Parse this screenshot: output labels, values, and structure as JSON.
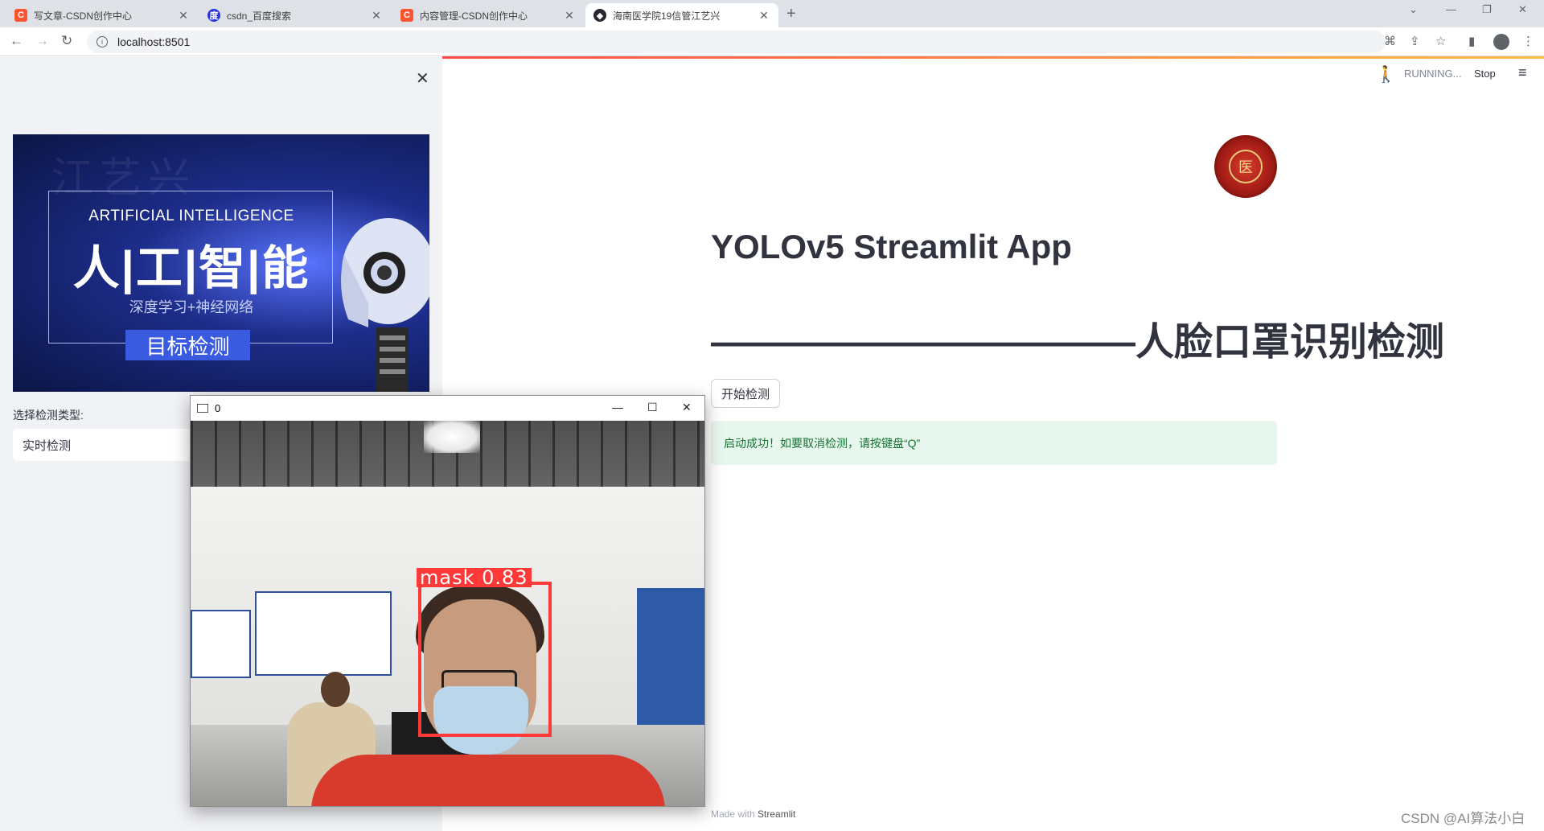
{
  "browser": {
    "tabs": [
      {
        "title": "写文章-CSDN创作中心",
        "favicon": "C",
        "color": "#fc5531"
      },
      {
        "title": "csdn_百度搜索",
        "favicon": "du",
        "color": "#2932e1"
      },
      {
        "title": "内容管理-CSDN创作中心",
        "favicon": "C",
        "color": "#fc5531"
      },
      {
        "title": "海南医学院19信管江艺兴",
        "favicon": "st",
        "color": "#262730"
      }
    ],
    "new_tab_icon": "+",
    "url": "localhost:8501"
  },
  "sidebar": {
    "banner": {
      "english": "ARTIFICIAL INTELLIGENCE",
      "chinese": "人|工|智|能",
      "subtitle": "深度学习+神经网络",
      "tag": "目标检测",
      "watermark": "江艺兴"
    },
    "select_label": "选择检测类型:",
    "select_value": "实时检测"
  },
  "header": {
    "status": "RUNNING...",
    "stop": "Stop"
  },
  "main": {
    "logo_text": "医",
    "title": "YOLOv5 Streamlit App",
    "subtitle": "———————————人脸口罩识别检测",
    "button": "开始检测",
    "alert": "启动成功！如要取消检测，请按键盘“Q”",
    "footer_prefix": "Made with",
    "footer_brand": "Streamlit"
  },
  "camera_window": {
    "title": "0",
    "detection_label": "mask  0.83"
  },
  "watermark": "CSDN @AI算法小白"
}
